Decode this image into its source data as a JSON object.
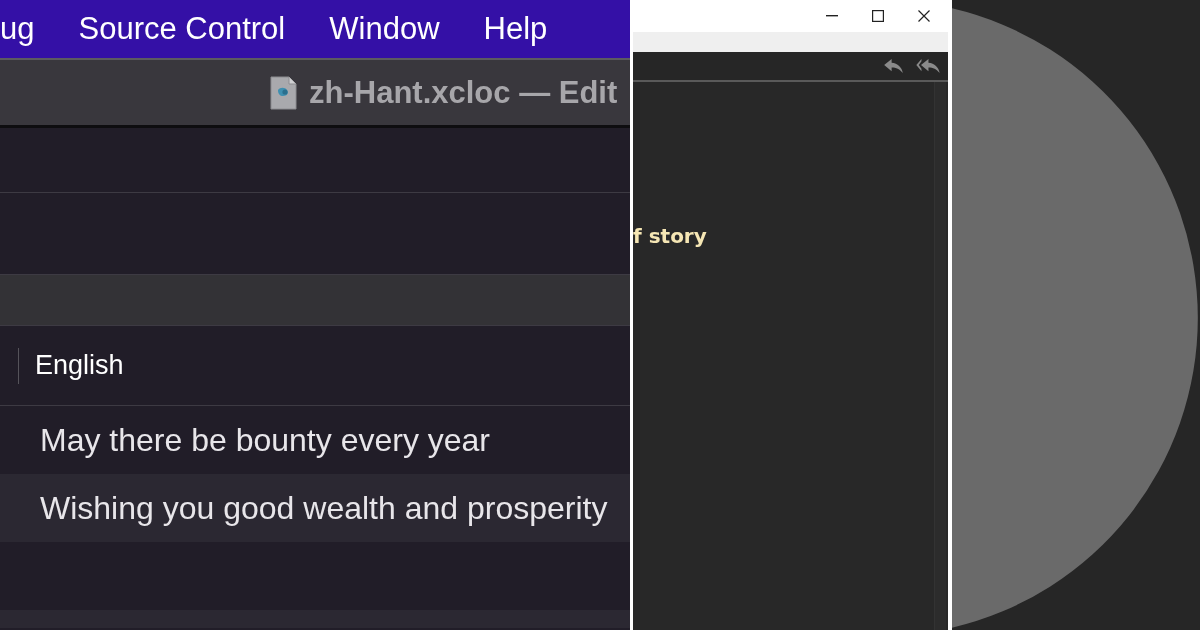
{
  "menu_bar": [
    "ug",
    "Source Control",
    "Window",
    "Help"
  ],
  "editor_window": {
    "title": "zh-Hant.xcloc — Edit",
    "table": {
      "columns": [
        "English"
      ],
      "rows": [
        {
          "english": "May there be bounty every year"
        },
        {
          "english": "Wishing you good wealth and prosperity"
        }
      ]
    }
  },
  "mail_window": {
    "content": "f story"
  }
}
